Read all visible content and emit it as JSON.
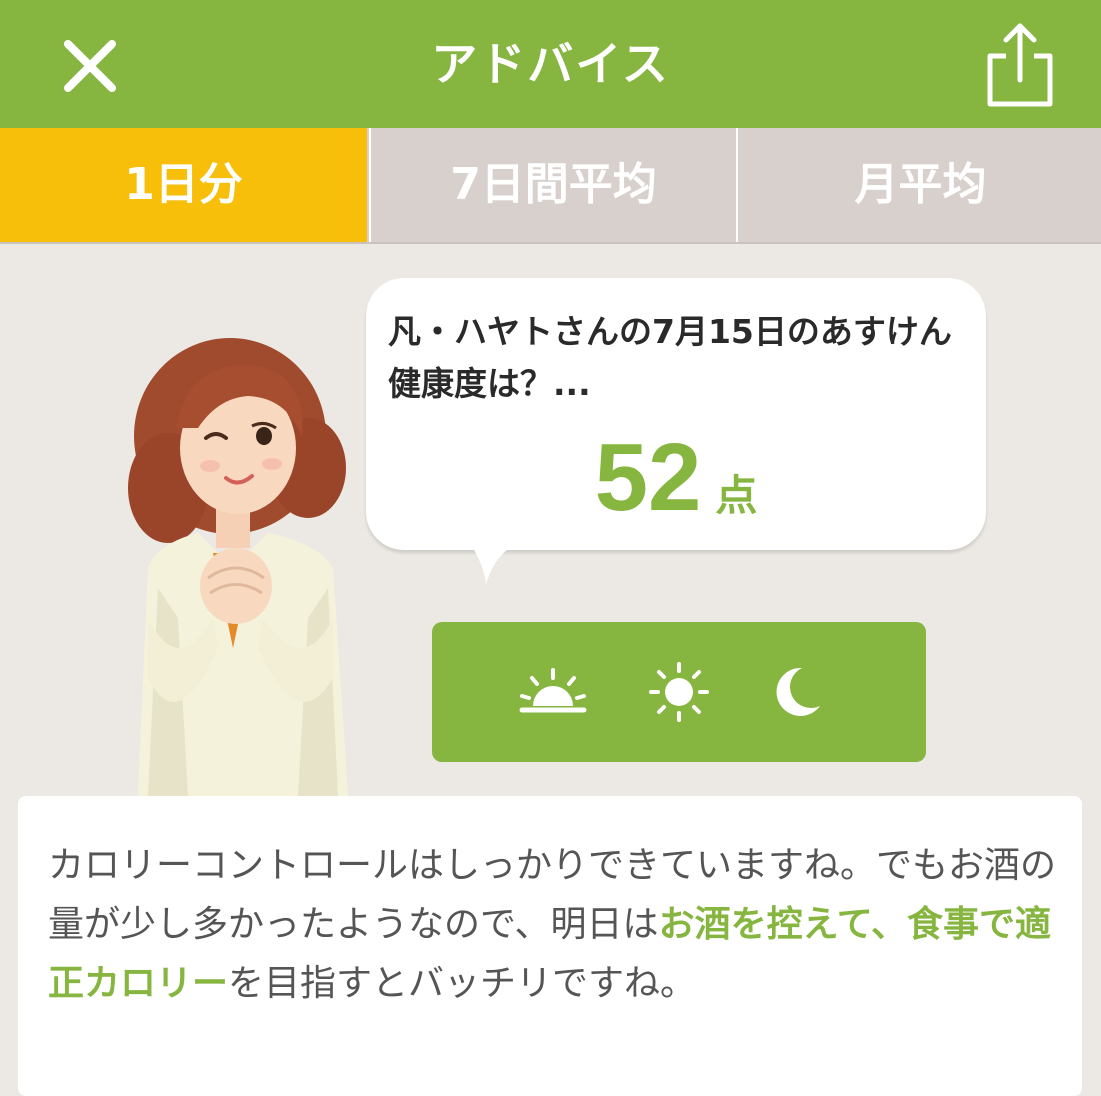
{
  "header": {
    "title": "アドバイス",
    "close_icon": "close-icon",
    "share_icon": "share-icon"
  },
  "tabs": [
    {
      "label": "1日分",
      "active": true
    },
    {
      "label": "7日間平均",
      "active": false
    },
    {
      "label": "月平均",
      "active": false
    }
  ],
  "bubble": {
    "question": "凡・ハヤトさんの7月15日のあすけん健康度は？...",
    "score": "52",
    "unit": "点"
  },
  "time_buttons": [
    {
      "icon": "sunrise-icon"
    },
    {
      "icon": "sun-icon"
    },
    {
      "icon": "moon-icon"
    }
  ],
  "advice": {
    "part1": "カロリーコントロールはしっかりできていますね。でもお酒の量が少し多かったようなので、明日は",
    "highlight": "お酒を控えて、食事で適正カロリー",
    "part2": "を目指すとバッチリですね。"
  },
  "colors": {
    "green": "#86b540",
    "tab_active": "#f8bf0a",
    "tab_inactive": "#d8d0cc",
    "background": "#ece9e4"
  }
}
